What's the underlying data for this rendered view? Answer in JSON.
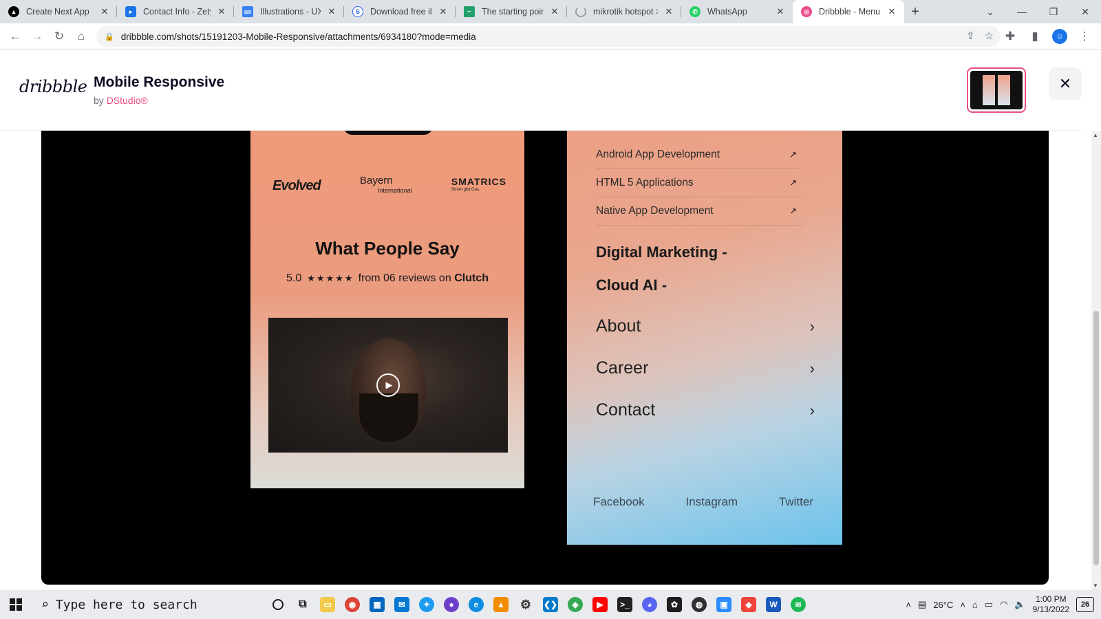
{
  "browser": {
    "tabs": [
      {
        "title": "Create Next App",
        "icon": "nextjs-icon",
        "color": "#000000"
      },
      {
        "title": "Contact Info - Zety",
        "icon": "zety-icon",
        "color": "#1a73e8"
      },
      {
        "title": "Illustrations - UX L",
        "icon": "ux-icon",
        "color": "#3b82f6"
      },
      {
        "title": "Download free illu",
        "icon": "storyset-icon",
        "color": "#2563eb"
      },
      {
        "title": "The starting point f",
        "icon": "starting-point-icon",
        "color": "#22a06b"
      },
      {
        "title": "mikrotik hotspot >",
        "icon": "loading-icon",
        "color": "#9aa0a6"
      },
      {
        "title": "WhatsApp",
        "icon": "whatsapp-icon",
        "color": "#25d366"
      },
      {
        "title": "Dribbble - Menu.p",
        "icon": "dribbble-icon",
        "color": "#ea4c89"
      }
    ],
    "url": "dribbble.com/shots/15191203-Mobile-Responsive/attachments/6934180?mode=media",
    "profile_initial": "☺"
  },
  "header": {
    "logo": "dribbble",
    "title": "Mobile Responsive",
    "by": "by",
    "author": "DStudio®"
  },
  "phone1": {
    "brands": {
      "b1": "Evolved",
      "b2": "Bayern",
      "b2_sub": "International",
      "b3": "SMATRICS",
      "b3_sub": "Strom gibt Gas."
    },
    "heading": "What People Say",
    "rating_score": "5.0",
    "rating_stars": "★★★★★",
    "rating_text": "from 06 reviews on",
    "rating_source": "Clutch"
  },
  "phone2": {
    "services": [
      "Android App Development",
      "HTML 5 Applications",
      "Native App Development"
    ],
    "categories": [
      "Digital Marketing -",
      "Cloud AI -"
    ],
    "nav": [
      "About",
      "Career",
      "Contact"
    ],
    "social": [
      "Facebook",
      "Instagram",
      "Twitter"
    ]
  },
  "taskbar": {
    "search_placeholder": "Type here to search",
    "weather": "26°C",
    "time": "1:00 PM",
    "date": "9/13/2022",
    "notifications": "26"
  }
}
